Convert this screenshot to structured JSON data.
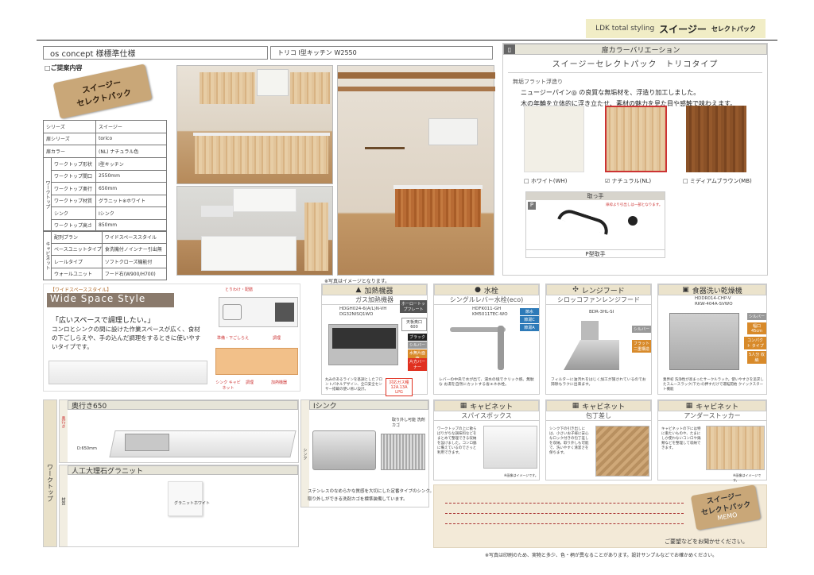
{
  "top_tab": {
    "prefix": "LDK total styling",
    "brand": "スイージー",
    "suffix": "セレクトパック"
  },
  "header": {
    "concept": "os concept 様標準仕様",
    "product": "トリコ Ⅰ型キッチン W2550"
  },
  "proposal_label": "□ご提案内容",
  "hang_tag": {
    "line1": "スイージー",
    "line2": "セレクトパック"
  },
  "spec_rows": [
    {
      "k": "シリーズ",
      "v": "スイージー"
    },
    {
      "k": "扉シリーズ",
      "v": "torico"
    },
    {
      "k": "扉カラー",
      "v": "(NL) ナチュラル色"
    }
  ],
  "worktop_group": "ワークトップ",
  "worktop_rows": [
    {
      "k": "ワークトップ形状",
      "v": "Ⅰ型キッチン"
    },
    {
      "k": "ワークトップ間口",
      "v": "2550mm"
    },
    {
      "k": "ワークトップ奥行",
      "v": "650mm"
    },
    {
      "k": "ワークトップ材質",
      "v": "グラニット※ホワイト"
    },
    {
      "k": "シンク",
      "v": "Ⅰシンク"
    },
    {
      "k": "ワークトップ高さ",
      "v": "850mm"
    }
  ],
  "cabinet_group": "キャビネット",
  "cabinet_rows": [
    {
      "k": "配列プラン",
      "v": "ワイドスペーススタイル"
    },
    {
      "k": "ベースユニットタイプ",
      "v": "食洗機付ノインナー引出無"
    },
    {
      "k": "レールタイプ",
      "v": "ソフトクローズ機能付"
    },
    {
      "k": "ウォールユニット",
      "v": "フード右(W900/H700)"
    }
  ],
  "door_variation": {
    "title": "扉カラーバリエーション",
    "subtitle": "スイージーセレクトパック　トリコタイプ",
    "finish_title": "無垢フラット浮造り",
    "desc1": "ニュージーパイン◎ の良質な無垢材を、浮造り加工しました。",
    "desc2": "木の年輪を立体的に浮き立たせ、素材の魅力を見た目や感触で味わえます。",
    "colors": [
      {
        "label": "□ ホワイト(WH)"
      },
      {
        "label": "☑ ナチュラル(NL)"
      },
      {
        "label": "□ ミディアムブラウン(MB)"
      }
    ],
    "handle_title": "取っ手",
    "handle_badge": "P",
    "handle_note": "扉枠より引出しは一部となります。",
    "handle_label": "P型取手"
  },
  "wide_space": {
    "tag": "【ワイドスペーススタイル】",
    "title": "Wide Space Style",
    "quote": "「広いスペースで調理したい。」",
    "body": "コンロとシンクの間に設けた作業スペースが広く、食材の下ごしらえや、手の込んだ調理をするときに使いやすいタイプです。",
    "diagram_labels": {
      "top": "とりわけ・配膳",
      "left": "準備・下ごしらえ",
      "right": "調理"
    },
    "bottom_labels": [
      "シンク キャビネット",
      "調理",
      "加熱機器"
    ]
  },
  "photo_note": "※写真はイメージとなります。",
  "heater": {
    "title": "加熱機器",
    "name": "ガス加熱機器",
    "model1": "HDGH024-6(A/L)N-VH",
    "model2": "DG32NISQ1WO",
    "side_badge": "ホーロートップフレート",
    "size_badge": "天板奥口 600",
    "colors": [
      "ブラック",
      "シルバー",
      "水無片面焼"
    ],
    "note": "丸みのあるラインを基調としたフロントパネルデザイン、全口安全センサー搭載の使い易い設計。",
    "gas": "対応ガス種 12A.13A LPG",
    "gas_tag": "片方バーナー"
  },
  "faucet": {
    "title": "水栓",
    "name": "シングルレバー水栓(eco)",
    "model1": "HDFK011-GH",
    "model2": "KM5011TEC-WO",
    "tags": [
      "節水",
      "節湯C",
      "節湯A"
    ],
    "note": "レバーの中央で水が出て、湯水の境でクリック感。無駄な お湯を自然にカットする省エネ水栓。"
  },
  "hood": {
    "title": "レンジフード",
    "name": "シロッコファンレンジフード",
    "model": "BDR-3HL-SI",
    "tags": [
      "シルバー",
      "フラット 二重構造"
    ],
    "note": "フィルターに油汚れをはじく加工が施されているのでお掃除もラクに出来ます。"
  },
  "dishwasher": {
    "title": "食器洗い乾燥機",
    "model1": "HDDR014-CHP-V",
    "model2": "RKW-404A-SVWO",
    "tags": [
      "シルバー",
      "幅口 45cm",
      "コンパクト タイプ",
      "5人分 収納"
    ],
    "note": "業界初 洗浄性が高まったサークルラック。使いやすさを追求したスムースラック(下カゴ)押すだけで運転開始 クイックスタート機能"
  },
  "depth": {
    "title": "奥行き650",
    "side": "奥行き",
    "dim": "D:650mm"
  },
  "worktop_side": "ワークトップ",
  "granite": {
    "title": "人工大理石グラニット",
    "side": "材質",
    "sample": "グラニットホワイト"
  },
  "sink": {
    "title": "Ⅰシンク",
    "side": "シンク",
    "tag": "取り外し可能 洗剤カゴ",
    "note1": "ステンレスのなめらかな質感を大切にした定番タイプのシンク。",
    "note2": "取り外しができる洗剤カゴを標準装備しています。"
  },
  "cab1": {
    "title": "キャビネット",
    "sub": "スパイスボックス",
    "text": "ワークトップの上に散らばりがちな調味料などをまとめて整理できる収納を設けました。コンロ脇に備えているのでさっと利用できます。",
    "note": "※画像はイメージです。"
  },
  "cab2": {
    "title": "キャビネット",
    "sub": "包丁差し",
    "text": "シンク下の引き出しには、小さいお子様に安心なロック付きの包丁差しを収納。取り外しも可能で、洗いやすく清潔さを保ちます。"
  },
  "cab3": {
    "title": "キャビネット",
    "sub": "アンダーストッカー",
    "text": "キャビネットの下には特に重たいものや、たまにしか使わないコンロや鍋類などを整理して収納できます。",
    "note": "※画像はイメージです。"
  },
  "memo": {
    "line1": "スイージー",
    "line2": "セレクトパック",
    "line3": "MEMO"
  },
  "memo_footer": "ご要望などをお聞かせください。",
  "footer": "※写真は印刷のため、実物と多少、色・柄が異なることがあります。設計サンプルなどでお確かめください。"
}
